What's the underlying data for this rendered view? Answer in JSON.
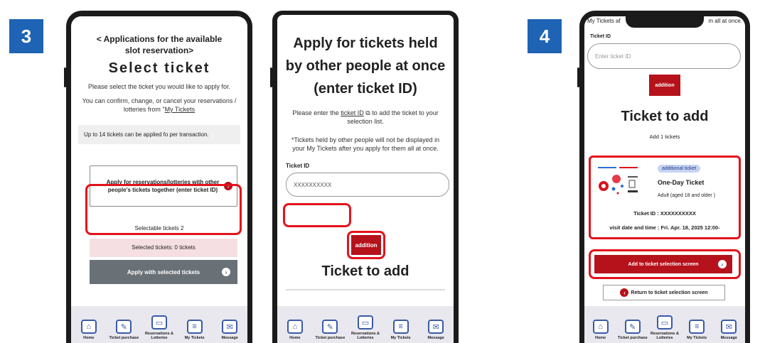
{
  "steps": {
    "step3": "3",
    "step4": "4"
  },
  "screen1": {
    "header_line1": "< Applications for the available",
    "header_line2": "slot reservation>",
    "title": "Select ticket",
    "instruction": "Please select the ticket you would like to apply for.",
    "confirm_text_prefix": "You can confirm, change, or cancel your reservations / lotteries from \"",
    "confirm_link": "My Tickets",
    "limit_note": "Up to 14 tickets can be applied fo per transaction.",
    "apply_others_button": "Apply for reservations/lotteries with other people's tickets together (enter ticket ID)",
    "selectable_count": "Selectable tickets 2",
    "selected_count": "Selected tickets: 0 tickets",
    "apply_selected_button": "Apply with selected tickets"
  },
  "screen2": {
    "title": "Apply for tickets held by other people at once (enter ticket ID)",
    "instruction_prefix": "Please enter the ",
    "ticket_id_link": "ticket ID",
    "instruction_suffix": " to add the ticket to your selection list.",
    "note": "*Tickets held by other people will not be displayed in your My Tickets after you apply for them all at once.",
    "field_label": "Ticket ID",
    "field_value": "XXXXXXXXXX",
    "add_button": "addition",
    "section_title": "Ticket to add"
  },
  "screen3": {
    "top_text_left": "My Tickets af",
    "top_text_right": "m all at once.",
    "field_label": "Ticket ID",
    "field_placeholder": "Enter ticket ID",
    "add_button": "addition",
    "section_title": "Ticket to add",
    "count_text": "Add 1 tickets",
    "badge": "additional ticket",
    "ticket_name": "One-Day Ticket",
    "ticket_type": "Adult (aged 18 and older )",
    "ticket_id": "Ticket ID : XXXXXXXXXX",
    "visit": "visit date and time : Fri. Apr. 18, 2025 12:00-",
    "add_to_selection_button": "Add to ticket selection screen",
    "return_button": "Return to ticket selection screen"
  },
  "nav": {
    "home": "Home",
    "purchase": "Ticket purchase",
    "reservations": "Reservations & Lotteries",
    "my_tickets": "My Tickets",
    "message": "Message"
  },
  "icons": [
    "home-icon",
    "ticket-icon",
    "calendar-icon",
    "clipboard-icon",
    "mail-icon"
  ],
  "colors": {
    "accent_blue": "#1e63b4",
    "brand_red": "#b5121b",
    "highlight_red": "#e3121b"
  }
}
